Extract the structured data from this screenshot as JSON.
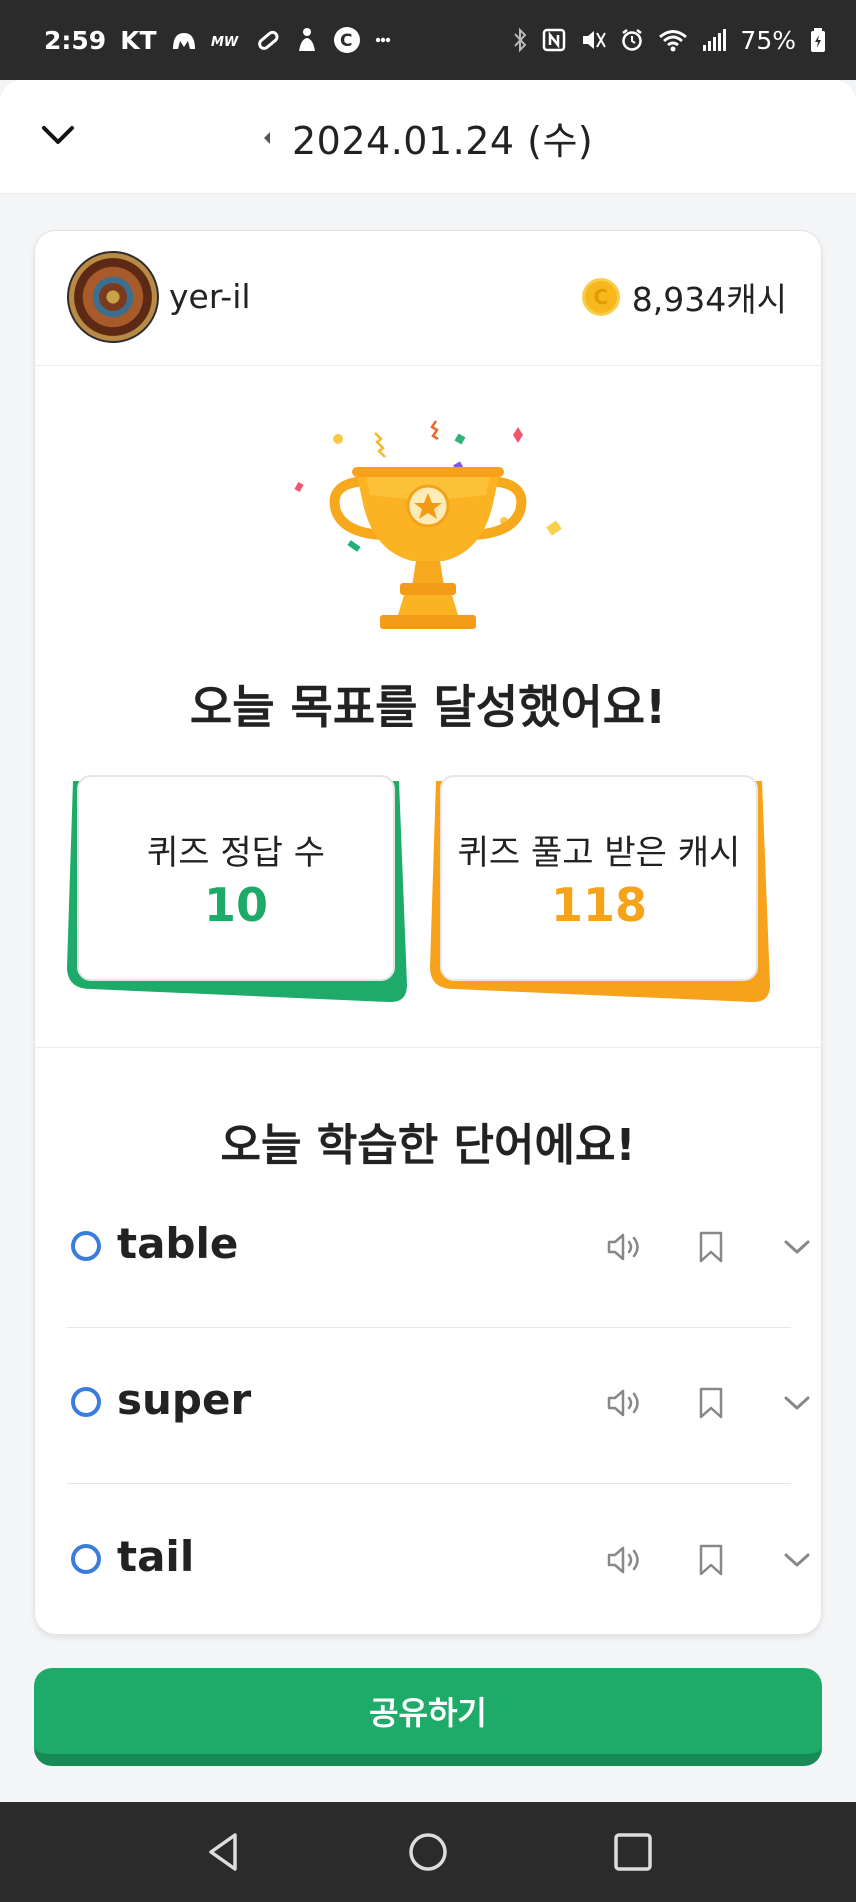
{
  "status_bar": {
    "time": "2:59",
    "carrier": "KT",
    "battery": "75%"
  },
  "header": {
    "date": "2024.01.24 (수)"
  },
  "profile": {
    "username": "yer-il",
    "cash": "8,934캐시"
  },
  "achievement": {
    "title": "오늘 목표를 달성했어요!"
  },
  "stats": [
    {
      "label": "퀴즈 정답 수",
      "value": "10",
      "color": "#1eab6a"
    },
    {
      "label": "퀴즈 풀고 받은 캐시",
      "value": "118",
      "color": "#f7a21b"
    }
  ],
  "words_section": {
    "title": "오늘 학습한 단어에요!",
    "words": [
      "table",
      "super",
      "tail"
    ]
  },
  "share_button": {
    "label": "공유하기"
  },
  "icons": {
    "collapse": "chevron-down-icon",
    "prev_day": "caret-left-icon",
    "coin": "coin-icon",
    "trophy": "trophy-icon",
    "speaker": "speaker-icon",
    "bookmark": "bookmark-icon",
    "expand": "chevron-down-icon"
  },
  "colors": {
    "primary_green": "#1eab6a",
    "accent_orange": "#f7a21b",
    "word_circle_blue": "#3b7ddd"
  }
}
